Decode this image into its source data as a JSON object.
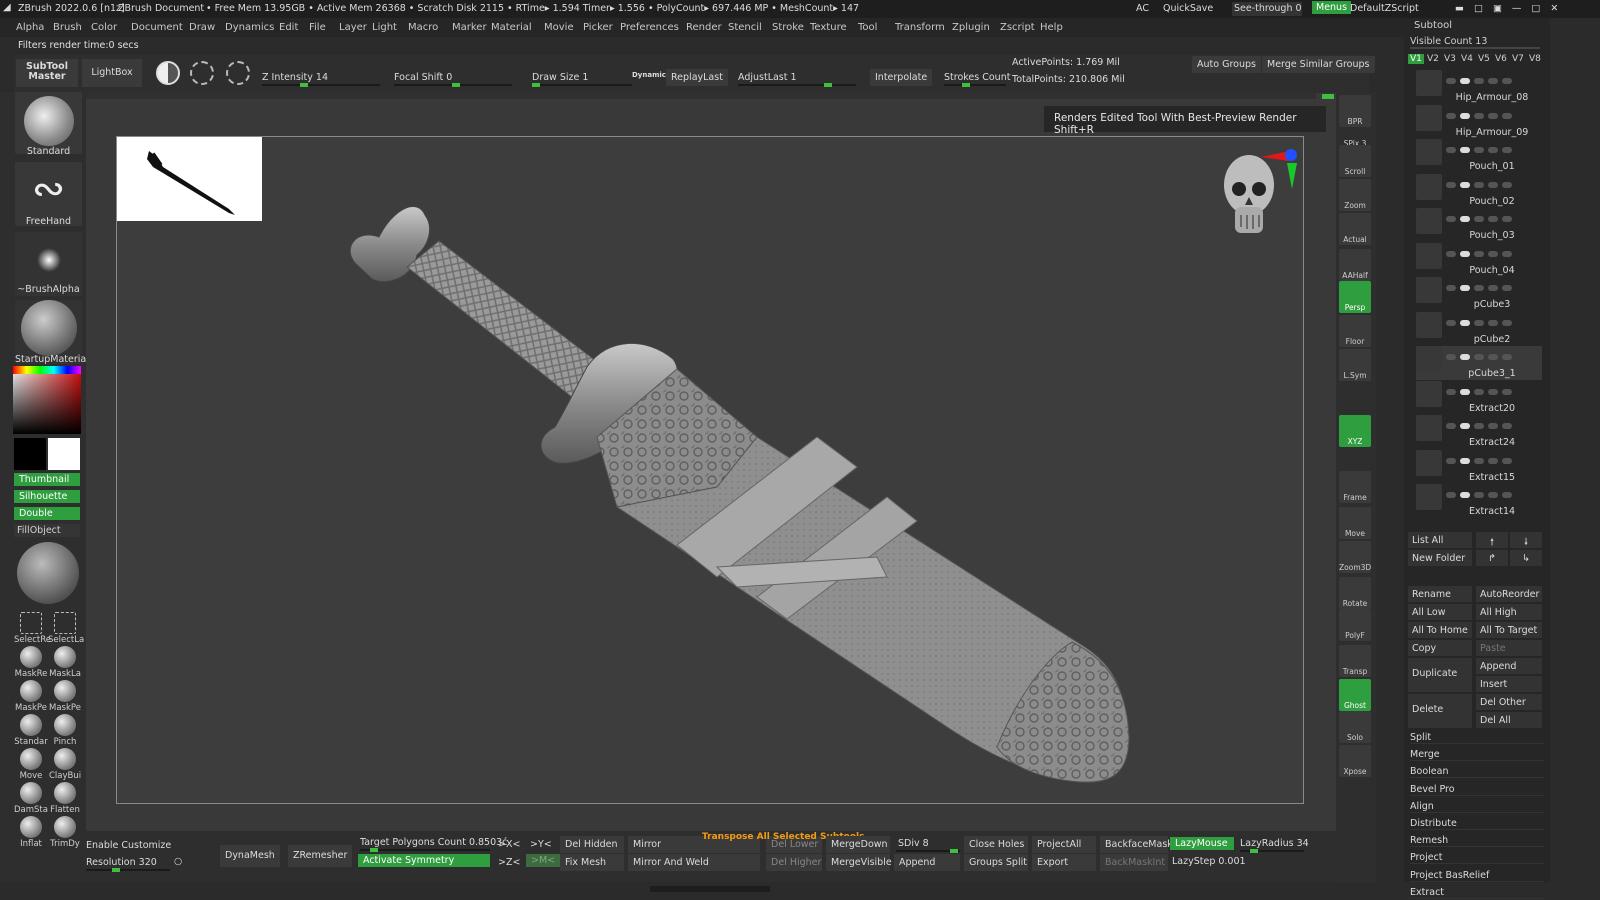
{
  "titlebar": {
    "app": "ZBrush 2022.0.6 [n1z]",
    "document": "ZBrush Document",
    "stats": "• Free Mem 13.95GB • Active Mem 26368 • Scratch Disk 2115 • RTime▸ 1.594 Timer▸ 1.556 • PolyCount▸ 697.446 MP • MeshCount▸ 147",
    "ac": "AC",
    "quicksave": "QuickSave",
    "seethrough": "See-through",
    "seethrough_value": "0",
    "menus": "Menus",
    "zscript": "DefaultZScript"
  },
  "menus": [
    "Alpha",
    "Brush",
    "Color",
    "Document",
    "Draw",
    "Dynamics",
    "Edit",
    "File",
    "Layer",
    "Light",
    "Macro",
    "Marker",
    "Material",
    "Movie",
    "Picker",
    "Preferences",
    "Render",
    "Stencil",
    "Stroke",
    "Texture",
    "Tool",
    "Transform",
    "Zplugin",
    "Zscript",
    "Help"
  ],
  "status_line": "Filters render time:0 secs",
  "topshelf": {
    "subtool_master": "SubTool Master",
    "lightbox": "LightBox",
    "z_intensity": "Z Intensity 14",
    "focal_shift": "Focal Shift 0",
    "draw_size": "Draw Size 1",
    "dynamic": "Dynamic",
    "replay_last": "ReplayLast",
    "adjust_last": "AdjustLast 1",
    "interpolate": "Interpolate",
    "strokes_count": "Strokes Count",
    "active_points": "ActivePoints: 1.769 Mil",
    "total_points": "TotalPoints: 210.806 Mil",
    "auto_groups": "Auto Groups",
    "merge_similar": "Merge Similar Groups"
  },
  "leftshelf": {
    "brush1": "Standard",
    "brush2": "FreeHand",
    "alpha": "~BrushAlpha",
    "material": "StartupMateria",
    "thumbnail": "Thumbnail",
    "silhouette": "Silhouette",
    "double": "Double",
    "fillobject": "FillObject",
    "small_brushes": [
      "SelectRe",
      "SelectLa",
      "MaskRe",
      "MaskLa",
      "MaskPe",
      "MaskPe",
      "Standar",
      "Pinch",
      "Move",
      "ClayBui",
      "DamSta",
      "Flatten",
      "Inflat",
      "TrimDy"
    ]
  },
  "tooltip": "Renders Edited Tool With Best-Preview Render  Shift+R",
  "rightshelf": [
    "BPR",
    "SPix 3",
    "Scroll",
    "Zoom",
    "Actual",
    "AAHalf",
    "Persp",
    "Floor",
    "L.Sym",
    "",
    "XYZ",
    "",
    "",
    "Frame",
    "Move",
    "Zoom3D",
    "Rotate",
    "PolyF",
    "Transp",
    "Ghost",
    "Solo",
    "Xpose"
  ],
  "subtool": {
    "header": "Subtool",
    "visible_count": "Visible Count 13",
    "versions": [
      "V1",
      "V2",
      "V3",
      "V4",
      "V5",
      "V6",
      "V7",
      "V8"
    ],
    "items": [
      "Hip_Armour_08",
      "Hip_Armour_09",
      "Pouch_01",
      "Pouch_02",
      "Pouch_03",
      "Pouch_04",
      "pCube3",
      "pCube2",
      "pCube3_1",
      "Extract20",
      "Extract24",
      "Extract15",
      "Extract14"
    ],
    "list_all": "List All",
    "new_folder": "New Folder",
    "rename": "Rename",
    "autoreorder": "AutoReorder",
    "all_low": "All Low",
    "all_high": "All High",
    "all_to_home": "All To Home",
    "all_to_target": "All To Target",
    "copy": "Copy",
    "paste": "Paste",
    "append": "Append",
    "duplicate": "Duplicate",
    "insert": "Insert",
    "delete": "Delete",
    "del_other": "Del Other",
    "del_all": "Del All",
    "actions": [
      "Split",
      "Merge",
      "Boolean",
      "Bevel Pro",
      "Align",
      "Distribute",
      "Remesh",
      "Project",
      "Project BasRelief",
      "Extract"
    ]
  },
  "bottomshelf": {
    "enable_customize": "Enable Customize",
    "resolution": "Resolution 320",
    "dynamesh": "DynaMesh",
    "zremesher": "ZRemesher",
    "target_poly": "Target Polygons Count 0.8503ć",
    "activate_symmetry": "Activate Symmetry",
    "x_sym": ">X<",
    "y_sym": ">Y<",
    "z_sym": ">Z<",
    "m_sym": ">M<",
    "del_hidden": "Del Hidden",
    "fix_mesh": "Fix Mesh",
    "mirror": "Mirror",
    "mirror_weld": "Mirror And Weld",
    "del_lower": "Del Lower",
    "del_higher": "Del Higher",
    "transpose": "Transpose All Selected Subtools",
    "merge_down": "MergeDown",
    "merge_visible": "MergeVisible",
    "sdiv": "SDiv 8",
    "append": "Append",
    "close_holes": "Close Holes",
    "groups_split": "Groups Split",
    "project_all": "ProjectAll",
    "export": "Export",
    "backface": "BackfaceMask",
    "backmask": "BackMaskInt",
    "lazymouse": "LazyMouse",
    "lazystep": "LazyStep 0.001",
    "lazyradius": "LazyRadius 34"
  },
  "colors": {
    "accent": "#2f9e3f",
    "panel": "#2e2e2e",
    "canvas": "#3d3d3d"
  }
}
